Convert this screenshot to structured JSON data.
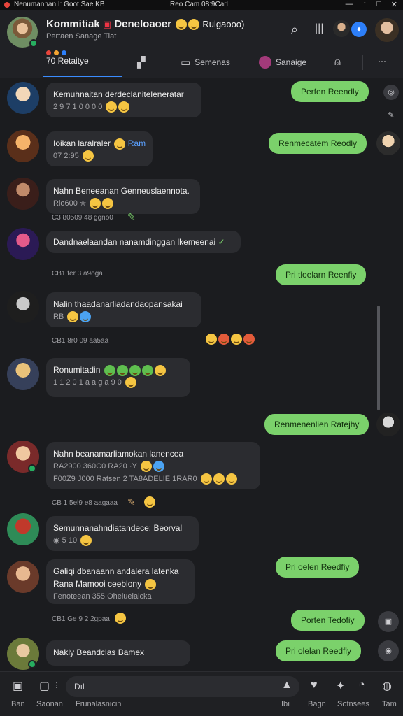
{
  "statusbar": {
    "left_text": "Nenumanhan I: Goot Sae  KB",
    "center_text": "Reo Cam 08:9Carl",
    "controls": [
      "—",
      "↑",
      "□",
      "✕"
    ]
  },
  "header": {
    "title": "Kommitiak",
    "title_extra": "Deneloaoer",
    "title_tail": "Rulgaooo)",
    "subtitle": "Pertaen Sanage Tiat",
    "tabs": [
      {
        "label": "70 Retaitye",
        "icon": "dots-icon"
      },
      {
        "label": "",
        "icon": "thumbs-up-icon"
      },
      {
        "label": "Semenas",
        "icon": "chat-icon"
      },
      {
        "label": "Sanaige",
        "icon": "avatar-icon"
      },
      {
        "label": "",
        "icon": "user-icon"
      },
      {
        "label": "",
        "icon": "more-icon"
      }
    ],
    "badge": "✦"
  },
  "messages": {
    "in": [
      {
        "text": "Kemuhnaitan derdeclaniteleneratar",
        "meta": "2 9 7 1 0 0 0 0"
      },
      {
        "text": "Ioikan laralraler",
        "highlight": "Ram",
        "meta": "07 2:95"
      },
      {
        "text": "Nahn Beneeanan Genneuslaennota.",
        "meta": "Rio600 ✭"
      },
      {
        "text": "Dandnaelaandan nanamdinggan lkemeenai"
      },
      {
        "text": "Nalin thaadanarliadandaopansakai",
        "meta": "RB"
      },
      {
        "text": "Ronumitadin",
        "meta": "1 1 2 0 1 a a g a 9 0"
      },
      {
        "text": "Nahn beanamarliamokan lanencea",
        "meta": "RA2900 360C0 RA20 ·Y",
        "meta2": "F00Z9 J000 Ratsen 2 TA8ADELIE 1RAR0"
      },
      {
        "text": "Semunnanahndiatandece: Beorval",
        "meta": "5 10"
      },
      {
        "text": "Galiqi dbanaann andalera latenka",
        "line2": "Rana Mamooi ceeblony",
        "meta": "Fenoteean 355 Oheluelaicka"
      },
      {
        "text": "Nakly Beandclas Bamex"
      }
    ],
    "out": [
      "Perfen Reendly",
      "Renmecatem Reodly",
      "Pri tloelarn Reenfiy",
      "Renmenenlien Ratejhy",
      "Pri oelen Reedfiy",
      "Porten Tedofiy",
      "Pri olelan Reedfiy"
    ],
    "timestamps": [
      "C3 80509 48 ggno0",
      "CB1 fer 3 a9oga",
      "CB1 8r0 09 aa5aa",
      "CB 1 5el9 e8 aagaaa",
      "CB1 Ge 9 2 2gpaa"
    ]
  },
  "bottom": {
    "input_value": "Dıl",
    "labels": [
      "Ban",
      "Saonan",
      "Frunalasnicin",
      "Ibı",
      "Bagn",
      "Sotnsees",
      "Tam"
    ]
  }
}
